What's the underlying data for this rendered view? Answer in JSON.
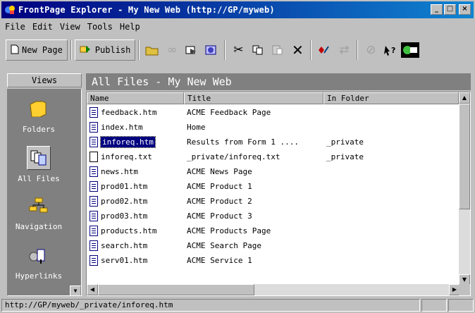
{
  "window": {
    "title": "FrontPage Explorer - My New Web (http://GP/myweb)",
    "minimize": "_",
    "maximize": "□",
    "close": "×"
  },
  "menu": [
    "File",
    "Edit",
    "View",
    "Tools",
    "Help"
  ],
  "toolbar": {
    "new_page": "New Page",
    "publish": "Publish"
  },
  "views": {
    "header": "Views",
    "items": [
      "Folders",
      "All Files",
      "Navigation",
      "Hyperlinks"
    ]
  },
  "pane_title": "All Files - My New Web",
  "columns": [
    "Name",
    "Title",
    "In Folder"
  ],
  "files": [
    {
      "name": "feedback.htm",
      "title": "ACME Feedback Page",
      "folder": ""
    },
    {
      "name": "index.htm",
      "title": "Home",
      "folder": ""
    },
    {
      "name": "inforeq.htm",
      "title": "Results from Form 1 ....",
      "folder": "_private"
    },
    {
      "name": "inforeq.txt",
      "title": "_private/inforeq.txt",
      "folder": "_private"
    },
    {
      "name": "news.htm",
      "title": "ACME News Page",
      "folder": ""
    },
    {
      "name": "prod01.htm",
      "title": "ACME Product 1",
      "folder": ""
    },
    {
      "name": "prod02.htm",
      "title": "ACME Product 2",
      "folder": ""
    },
    {
      "name": "prod03.htm",
      "title": "ACME Product 3",
      "folder": ""
    },
    {
      "name": "products.htm",
      "title": "ACME Products Page",
      "folder": ""
    },
    {
      "name": "search.htm",
      "title": "ACME Search Page",
      "folder": ""
    },
    {
      "name": "serv01.htm",
      "title": "ACME Service 1",
      "folder": ""
    }
  ],
  "selected_file": "inforeq.htm",
  "status": "http://GP/myweb/_private/inforeq.htm",
  "colors": {
    "title_start": "#000080",
    "title_end": "#1084d0",
    "selection": "#000080",
    "panel_gray": "#808080"
  }
}
